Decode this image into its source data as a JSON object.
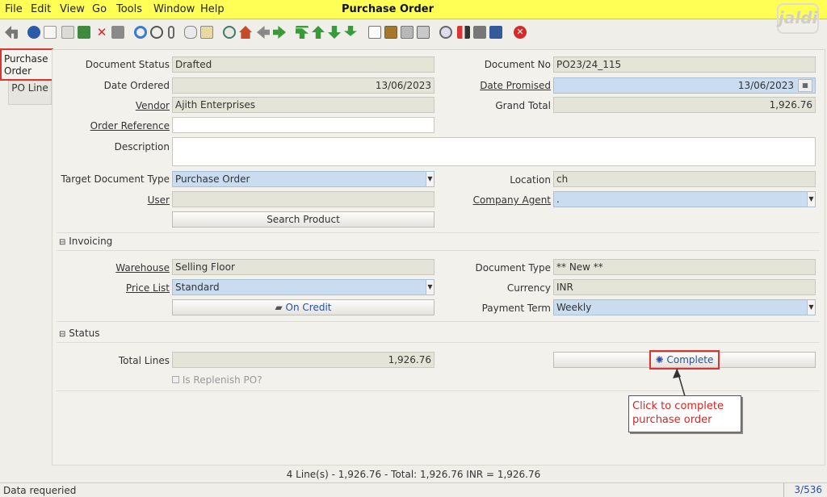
{
  "menu": {
    "file": "File",
    "edit": "Edit",
    "view": "View",
    "go": "Go",
    "tools": "Tools",
    "window": "Window",
    "help": "Help",
    "title": "Purchase Order"
  },
  "logo_text": "jaldi",
  "toolbar_icons": [
    "undo-icon",
    "help-icon",
    "new-icon",
    "copy-icon",
    "save-new-icon",
    "delete-icon",
    "save-icon",
    "refresh-icon",
    "find-icon",
    "attachment-icon",
    "chat-icon",
    "history-icon",
    "home-icon",
    "back-icon",
    "forward-icon",
    "first-record-icon",
    "previous-record-icon",
    "next-record-icon",
    "last-record-icon",
    "report-icon",
    "archive-icon",
    "print-preview-icon",
    "print-icon",
    "zoom-across-icon",
    "workflow-icon",
    "request-icon",
    "product-info-icon",
    "close-icon"
  ],
  "tabs": {
    "active": "Purchase Order",
    "second": "PO Line"
  },
  "form": {
    "document_status_label": "Document Status",
    "document_status": "Drafted",
    "document_no_label": "Document No",
    "document_no": "PO23/24_115",
    "date_ordered_label": "Date Ordered",
    "date_ordered": "13/06/2023",
    "date_promised_label": "Date Promised",
    "date_promised": "13/06/2023",
    "vendor_label": "Vendor",
    "vendor": "Ajith Enterprises",
    "grand_total_label": "Grand Total",
    "grand_total": "1,926.76",
    "order_reference_label": "Order Reference",
    "order_reference": "",
    "description_label": "Description",
    "description": "",
    "target_doc_type_label": "Target Document Type",
    "target_doc_type": "Purchase Order",
    "location_label": "Location",
    "location": "ch",
    "user_label": "User",
    "user": "",
    "company_agent_label": "Company Agent",
    "company_agent": ".",
    "search_product": "Search Product"
  },
  "invoicing": {
    "header": "Invoicing",
    "warehouse_label": "Warehouse",
    "warehouse": "Selling Floor",
    "document_type_label": "Document Type",
    "document_type": "** New **",
    "price_list_label": "Price List",
    "price_list": "Standard",
    "currency_label": "Currency",
    "currency": "INR",
    "on_credit": "On Credit",
    "payment_term_label": "Payment Term",
    "payment_term": "Weekly"
  },
  "status": {
    "header": "Status",
    "total_lines_label": "Total Lines",
    "total_lines": "1,926.76",
    "complete": "Complete",
    "is_replenish": "Is Replenish PO?"
  },
  "callout": "Click to complete purchase order",
  "summary": "4 Line(s) - 1,926.76 -  Total: 1,926.76  INR  =  1,926.76",
  "bottom": {
    "status": "Data requeried",
    "record": "3/536"
  },
  "colors": {
    "menubar": "#ffff55",
    "mandatory_field": "#c9dcf0",
    "readonly_field": "#e5e4d8",
    "highlight": "#dd3333"
  }
}
